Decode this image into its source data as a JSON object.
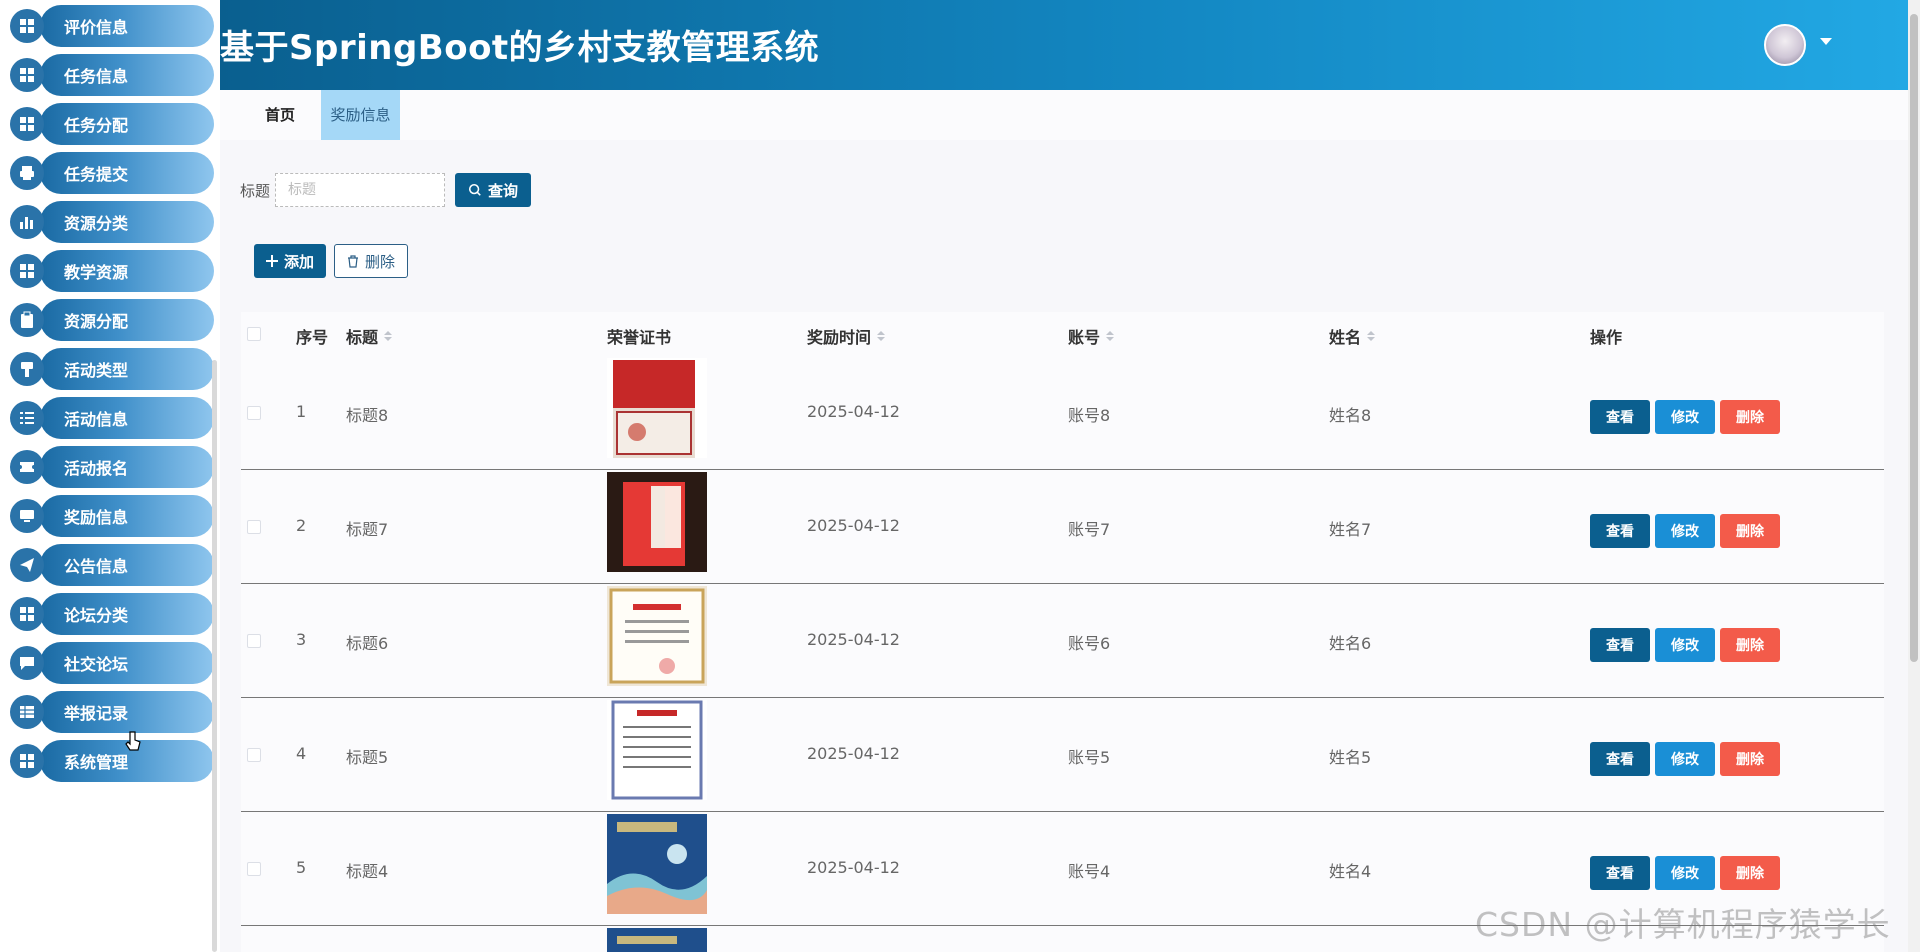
{
  "header": {
    "title": "基于SpringBoot的乡村支教管理系统"
  },
  "sidebar": {
    "items": [
      {
        "label": "评价信息",
        "icon": "grid-icon"
      },
      {
        "label": "任务信息",
        "icon": "grid-icon"
      },
      {
        "label": "任务分配",
        "icon": "grid-icon"
      },
      {
        "label": "任务提交",
        "icon": "printer-icon"
      },
      {
        "label": "资源分类",
        "icon": "bar-chart-icon"
      },
      {
        "label": "教学资源",
        "icon": "grid-icon"
      },
      {
        "label": "资源分配",
        "icon": "clipboard-icon"
      },
      {
        "label": "活动类型",
        "icon": "brush-icon"
      },
      {
        "label": "活动信息",
        "icon": "list-icon"
      },
      {
        "label": "活动报名",
        "icon": "ticket-icon"
      },
      {
        "label": "奖励信息",
        "icon": "monitor-icon"
      },
      {
        "label": "公告信息",
        "icon": "send-icon"
      },
      {
        "label": "论坛分类",
        "icon": "grid-icon"
      },
      {
        "label": "社交论坛",
        "icon": "chat-icon"
      },
      {
        "label": "举报记录",
        "icon": "table-icon"
      },
      {
        "label": "系统管理",
        "icon": "grid-icon"
      }
    ]
  },
  "tabs": {
    "home": "首页",
    "active": "奖励信息"
  },
  "search": {
    "label": "标题",
    "placeholder": "标题",
    "query_button": "查询"
  },
  "toolbar": {
    "add_button": "添加",
    "delete_button": "删除"
  },
  "table": {
    "headers": {
      "index": "序号",
      "title": "标题",
      "certificate": "荣誉证书",
      "time": "奖励时间",
      "account": "账号",
      "name": "姓名",
      "actions": "操作"
    },
    "action_labels": {
      "view": "查看",
      "edit": "修改",
      "delete": "删除"
    },
    "rows": [
      {
        "index": "1",
        "title": "标题8",
        "time": "2025-04-12",
        "account": "账号8",
        "name": "姓名8"
      },
      {
        "index": "2",
        "title": "标题7",
        "time": "2025-04-12",
        "account": "账号7",
        "name": "姓名7"
      },
      {
        "index": "3",
        "title": "标题6",
        "time": "2025-04-12",
        "account": "账号6",
        "name": "姓名6"
      },
      {
        "index": "4",
        "title": "标题5",
        "time": "2025-04-12",
        "account": "账号5",
        "name": "姓名5"
      },
      {
        "index": "5",
        "title": "标题4",
        "time": "2025-04-12",
        "account": "账号4",
        "name": "姓名4"
      }
    ]
  },
  "watermark": "CSDN @计算机程序猿学长",
  "colors": {
    "primary": "#0b5f8f",
    "edit": "#1a8fd6",
    "danger": "#f35b4a",
    "tab_active": "#a5d8f7"
  }
}
